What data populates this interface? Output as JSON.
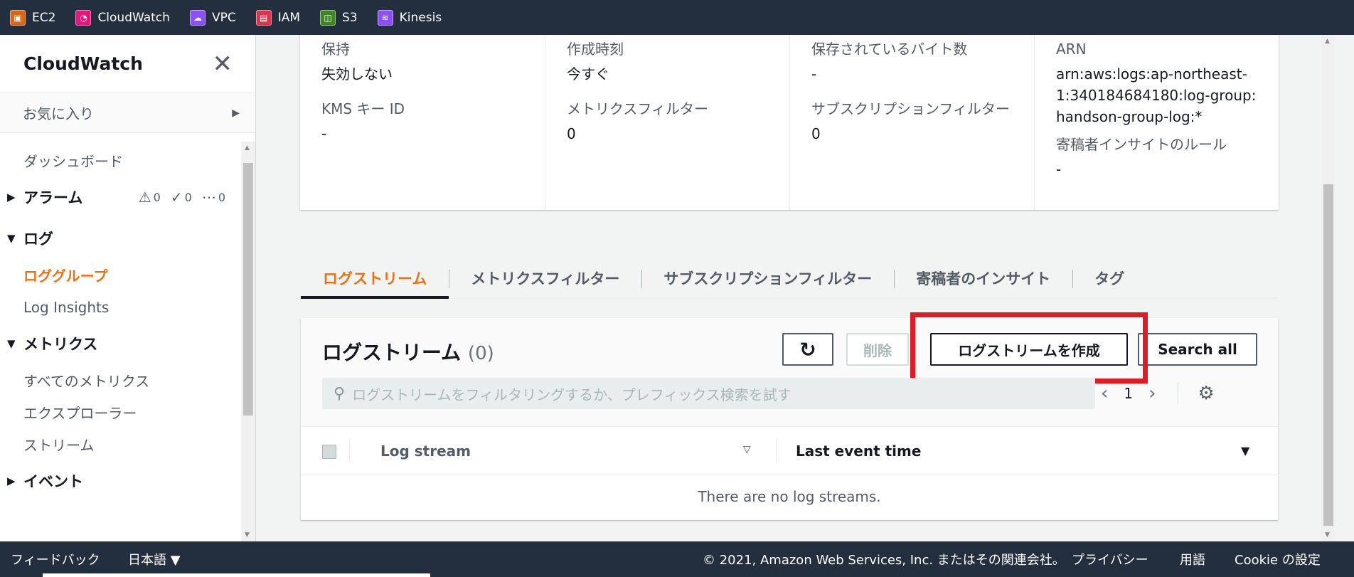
{
  "topbar": {
    "services": [
      {
        "label": "EC2",
        "icon": "ec2-icon",
        "color": "#d86613"
      },
      {
        "label": "CloudWatch",
        "icon": "cloudwatch-icon",
        "color": "#e7157b"
      },
      {
        "label": "VPC",
        "icon": "vpc-icon",
        "color": "#8c4fff"
      },
      {
        "label": "IAM",
        "icon": "iam-icon",
        "color": "#dd344c"
      },
      {
        "label": "S3",
        "icon": "s3-icon",
        "color": "#3f8624"
      },
      {
        "label": "Kinesis",
        "icon": "kinesis-icon",
        "color": "#8c4fff"
      }
    ]
  },
  "sidebar": {
    "title": "CloudWatch",
    "favorites": "お気に入り",
    "dashboard": "ダッシュボード",
    "alarms": {
      "label": "アラーム",
      "alarm_count": "0",
      "ok_count": "0",
      "insufficient_count": "0"
    },
    "logs": {
      "label": "ログ",
      "items": [
        "ロググループ",
        "Log Insights"
      ]
    },
    "metrics": {
      "label": "メトリクス",
      "items": [
        "すべてのメトリクス",
        "エクスプローラー",
        "ストリーム"
      ]
    },
    "events": {
      "label": "イベント"
    }
  },
  "details": {
    "retention": {
      "label": "保持",
      "value": "失効しない"
    },
    "kms": {
      "label": "KMS キー ID",
      "value": "-"
    },
    "created": {
      "label": "作成時刻",
      "value": "今すぐ"
    },
    "metric_filters": {
      "label": "メトリクスフィルター",
      "value": "0"
    },
    "stored_bytes": {
      "label": "保存されているバイト数",
      "value": "-"
    },
    "subscription_filters": {
      "label": "サブスクリプションフィルター",
      "value": "0"
    },
    "arn": {
      "label": "ARN",
      "value": "arn:aws:logs:ap-northeast-1:340184684180:log-group:handson-group-log:*"
    },
    "contributor_rules": {
      "label": "寄稿者インサイトのルール",
      "value": "-"
    }
  },
  "tabs": [
    "ログストリーム",
    "メトリクスフィルター",
    "サブスクリプションフィルター",
    "寄稿者のインサイト",
    "タグ"
  ],
  "panel": {
    "title": "ログストリーム",
    "count": "(0)",
    "delete_label": "削除",
    "create_label": "ログストリームを作成",
    "search_all_label": "Search all",
    "search_placeholder": "ログストリームをフィルタリングするか、プレフィックス検索を試す",
    "page": "1",
    "col_log_stream": "Log stream",
    "col_last_event": "Last event time",
    "empty_text": "There are no log streams."
  },
  "footer": {
    "feedback": "フィードバック",
    "language": "日本語 ▼",
    "copyright": "© 2021, Amazon Web Services, Inc. またはその関連会社。",
    "privacy": "プライバシー",
    "terms": "用語",
    "cookies": "Cookie の設定"
  },
  "colors": {
    "accent": "#ec7211",
    "nav_bg": "#232f3e",
    "highlight": "#e01b24"
  }
}
